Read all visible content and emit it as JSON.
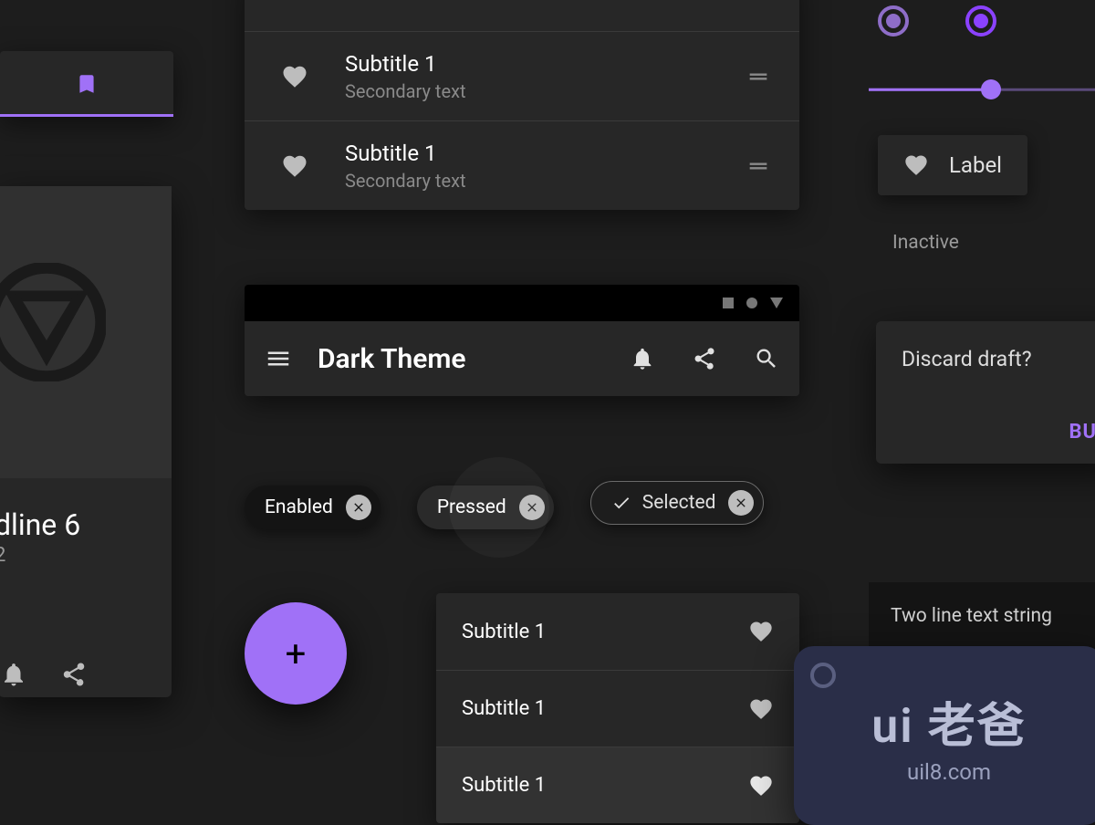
{
  "colors": {
    "accent": "#a071f7",
    "bg": "#1d1d1d",
    "surface": "#272727"
  },
  "tabcard": {
    "icon": "bookmark-icon"
  },
  "media": {
    "headline": "dline 6",
    "sub": "2"
  },
  "list_two": {
    "items": [
      {
        "title": "Subtitle 1",
        "secondary": "Secondary text"
      },
      {
        "title": "Subtitle 1",
        "secondary": "Secondary text"
      }
    ]
  },
  "appbar": {
    "title": "Dark Theme"
  },
  "chips": {
    "enabled": "Enabled",
    "pressed": "Pressed",
    "selected": "Selected"
  },
  "fab": {
    "glyph": "+"
  },
  "list_simple": {
    "items": [
      {
        "title": "Subtitle 1",
        "active": false
      },
      {
        "title": "Subtitle 1",
        "active": false
      },
      {
        "title": "Subtitle 1",
        "active": true
      }
    ]
  },
  "slider": {
    "value_pct": 52
  },
  "label_chip": {
    "text": "Label",
    "state": "Inactive"
  },
  "dialog": {
    "title": "Discard draft?",
    "button": "BU"
  },
  "snack": {
    "text": "Two line text string"
  },
  "watermark": {
    "brand": "ui 老爸",
    "url": "uil8.com"
  }
}
